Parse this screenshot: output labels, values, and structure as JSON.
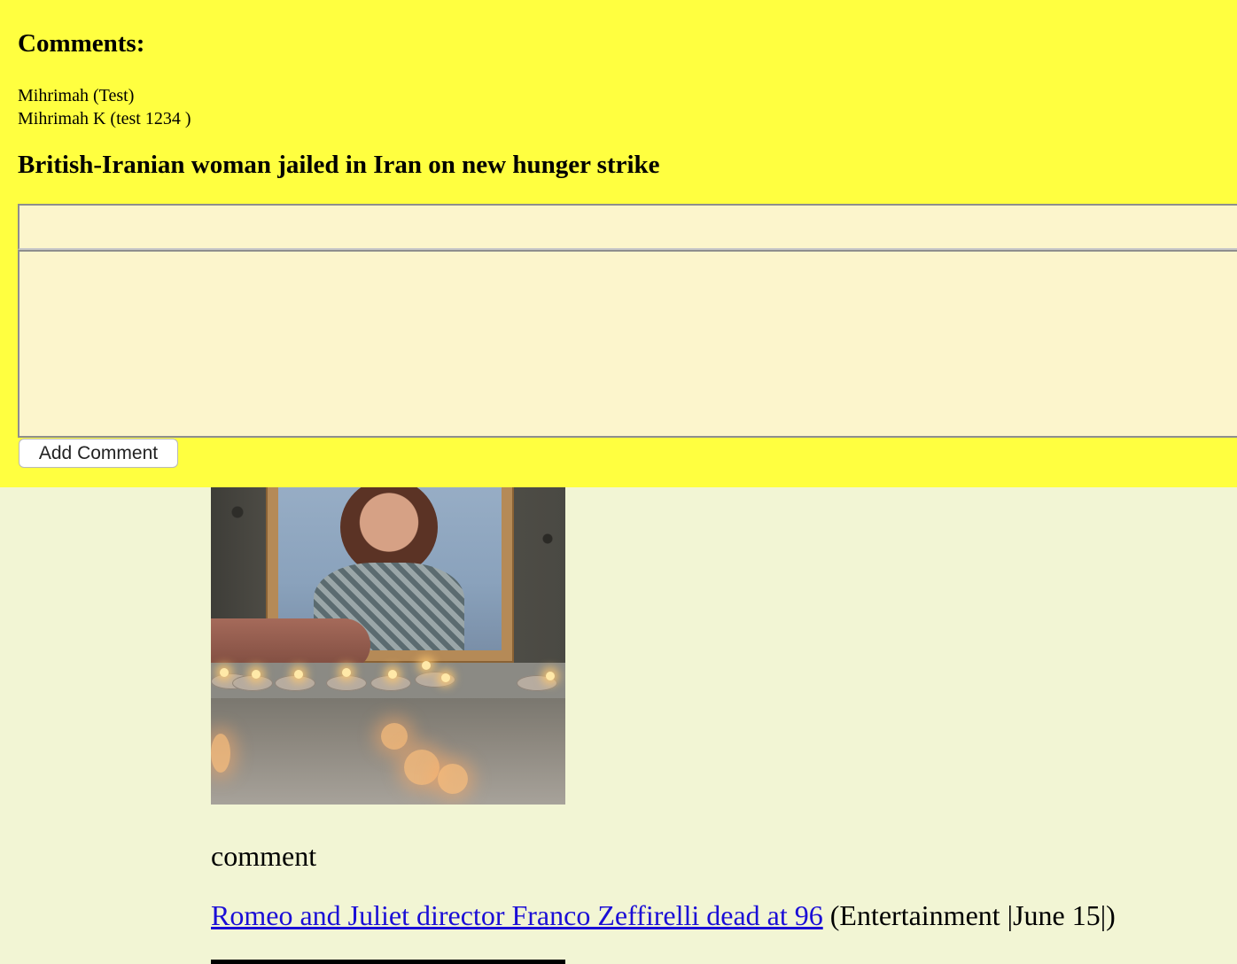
{
  "comments_panel": {
    "heading": "Comments:",
    "comments": [
      {
        "text": "Mihrimah (Test)"
      },
      {
        "text": "Mihrimah K (test 1234 )"
      }
    ],
    "article_title": "British-Iranian woman jailed in Iran on new hunger strike",
    "title_field": {
      "value": "",
      "placeholder": ""
    },
    "body_field": {
      "value": "",
      "placeholder": ""
    },
    "add_button_label": "Add Comment",
    "background_color": "#ffff40"
  },
  "feed": {
    "comment_label": "comment",
    "next_article": {
      "link_text": "Romeo and Juliet director Franco Zeffirelli dead at 96",
      "meta": "(Entertainment |June 15|)"
    },
    "background_color": "#f2f5d4",
    "link_color": "#1a0dd6"
  }
}
